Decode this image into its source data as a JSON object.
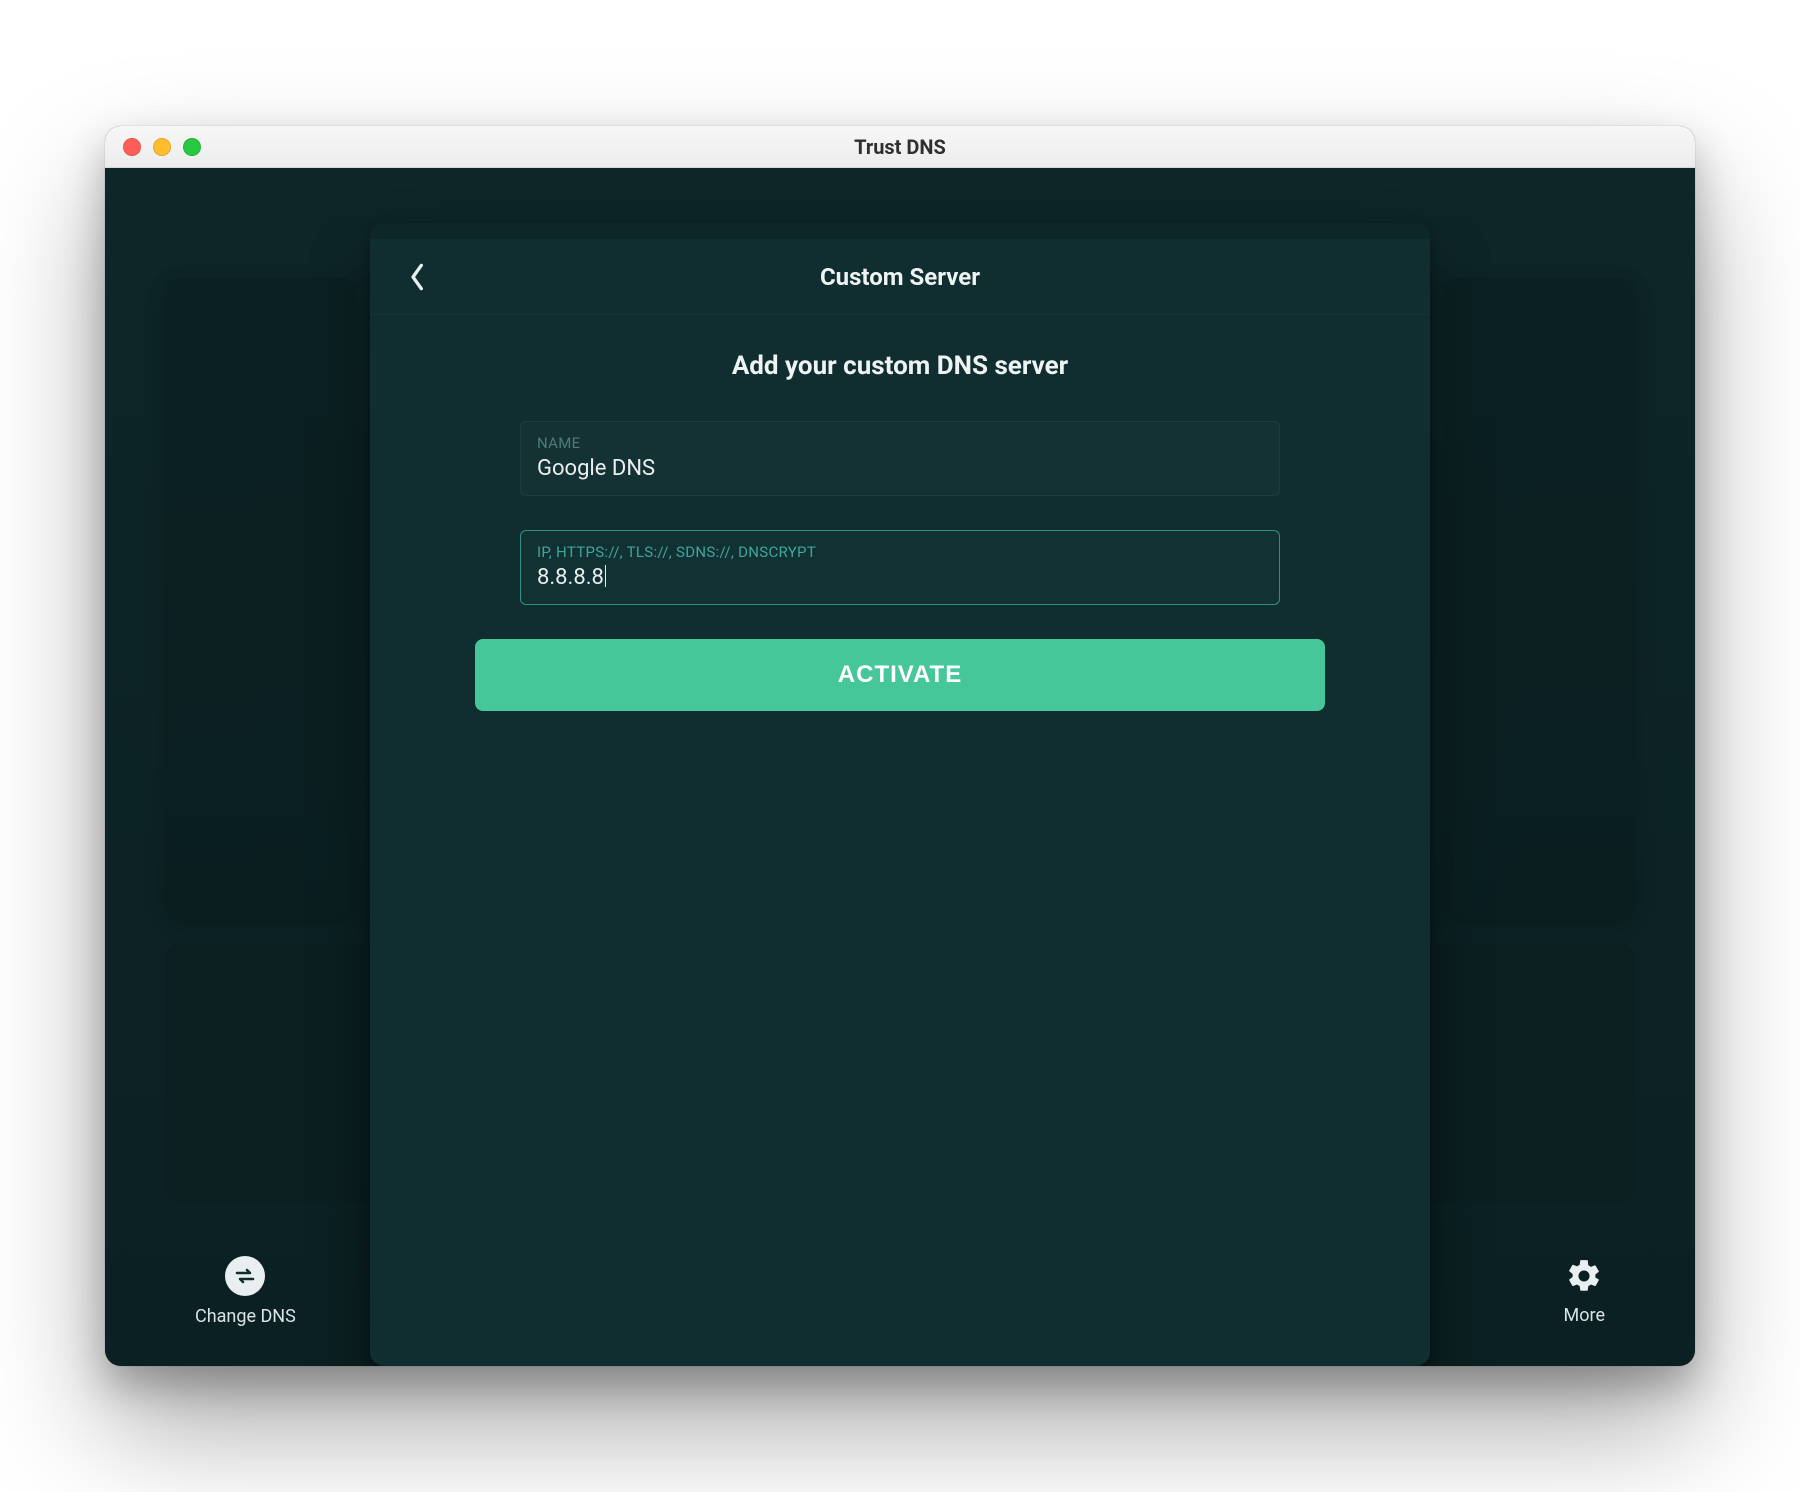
{
  "window": {
    "title": "Trust DNS"
  },
  "modal": {
    "title": "Custom Server",
    "subtitle": "Add your custom DNS server",
    "name_field": {
      "label": "NAME",
      "value": "Google DNS"
    },
    "address_field": {
      "label": "IP, HTTPS://, TLS://, SDNS://, DNSCRYPT",
      "value": "8.8.8.8"
    },
    "activate_label": "ACTIVATE"
  },
  "toolbar": {
    "change_dns_label": "Change DNS",
    "more_label": "More"
  },
  "colors": {
    "accent": "#45c79a",
    "panel": "#102d2f",
    "focus_border": "#2f8f86"
  }
}
